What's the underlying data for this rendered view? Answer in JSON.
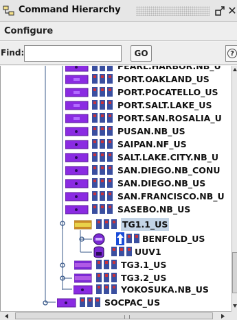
{
  "window": {
    "title": "Command Hierarchy"
  },
  "menu": {
    "items": [
      "Configure"
    ]
  },
  "find": {
    "label": "Find:",
    "value": "",
    "go_label": "GO",
    "help_glyph": "?"
  },
  "tree": {
    "partial_top_label": "PEARL.HARBOR.NB_U",
    "nodes": [
      {
        "label": "PORT.OAKLAND_US",
        "icon": "purple-folder-icon"
      },
      {
        "label": "PORT.POCATELLO_US",
        "icon": "purple-folder-icon"
      },
      {
        "label": "PORT.SALT.LAKE_US",
        "icon": "purple-folder-icon"
      },
      {
        "label": "PORT.SAN.ROSALIA_U",
        "icon": "purple-folder-icon"
      },
      {
        "label": "PUSAN.NB_US",
        "icon": "purple-folder-icon"
      },
      {
        "label": "SAIPAN.NF_US",
        "icon": "purple-folder-icon"
      },
      {
        "label": "SALT.LAKE.CITY.NB_U",
        "icon": "purple-folder-icon"
      },
      {
        "label": "SAN.DIEGO.NB_CONU",
        "icon": "purple-folder-icon"
      },
      {
        "label": "SAN.DIEGO.NB_US",
        "icon": "purple-folder-icon"
      },
      {
        "label": "SAN.FRANCISCO.NB_U",
        "icon": "purple-folder-icon"
      },
      {
        "label": "SASEBO.NB_US",
        "icon": "purple-folder-icon"
      },
      {
        "label": "TG1.1_US",
        "icon": "yellow-group-icon",
        "selected": true
      },
      {
        "label": "BENFOLD_US",
        "icon": "ship-icon"
      },
      {
        "label": "UUV1",
        "icon": "uuv-icon"
      },
      {
        "label": "TG3.1_US",
        "icon": "purple-group-icon"
      },
      {
        "label": "TG3.2_US",
        "icon": "purple-group-icon"
      },
      {
        "label": "YOKOSUKA.NB_US",
        "icon": "purple-folder-icon"
      },
      {
        "label": "SOCPAC_US",
        "icon": "purple-folder-icon"
      }
    ]
  },
  "colors": {
    "folder_purple": "#8a2be2",
    "group_yellow": "#e9d34a",
    "selection": "#c3d4e6",
    "flag_blue": "#3a4fa0",
    "flag_red": "#c8323c"
  }
}
